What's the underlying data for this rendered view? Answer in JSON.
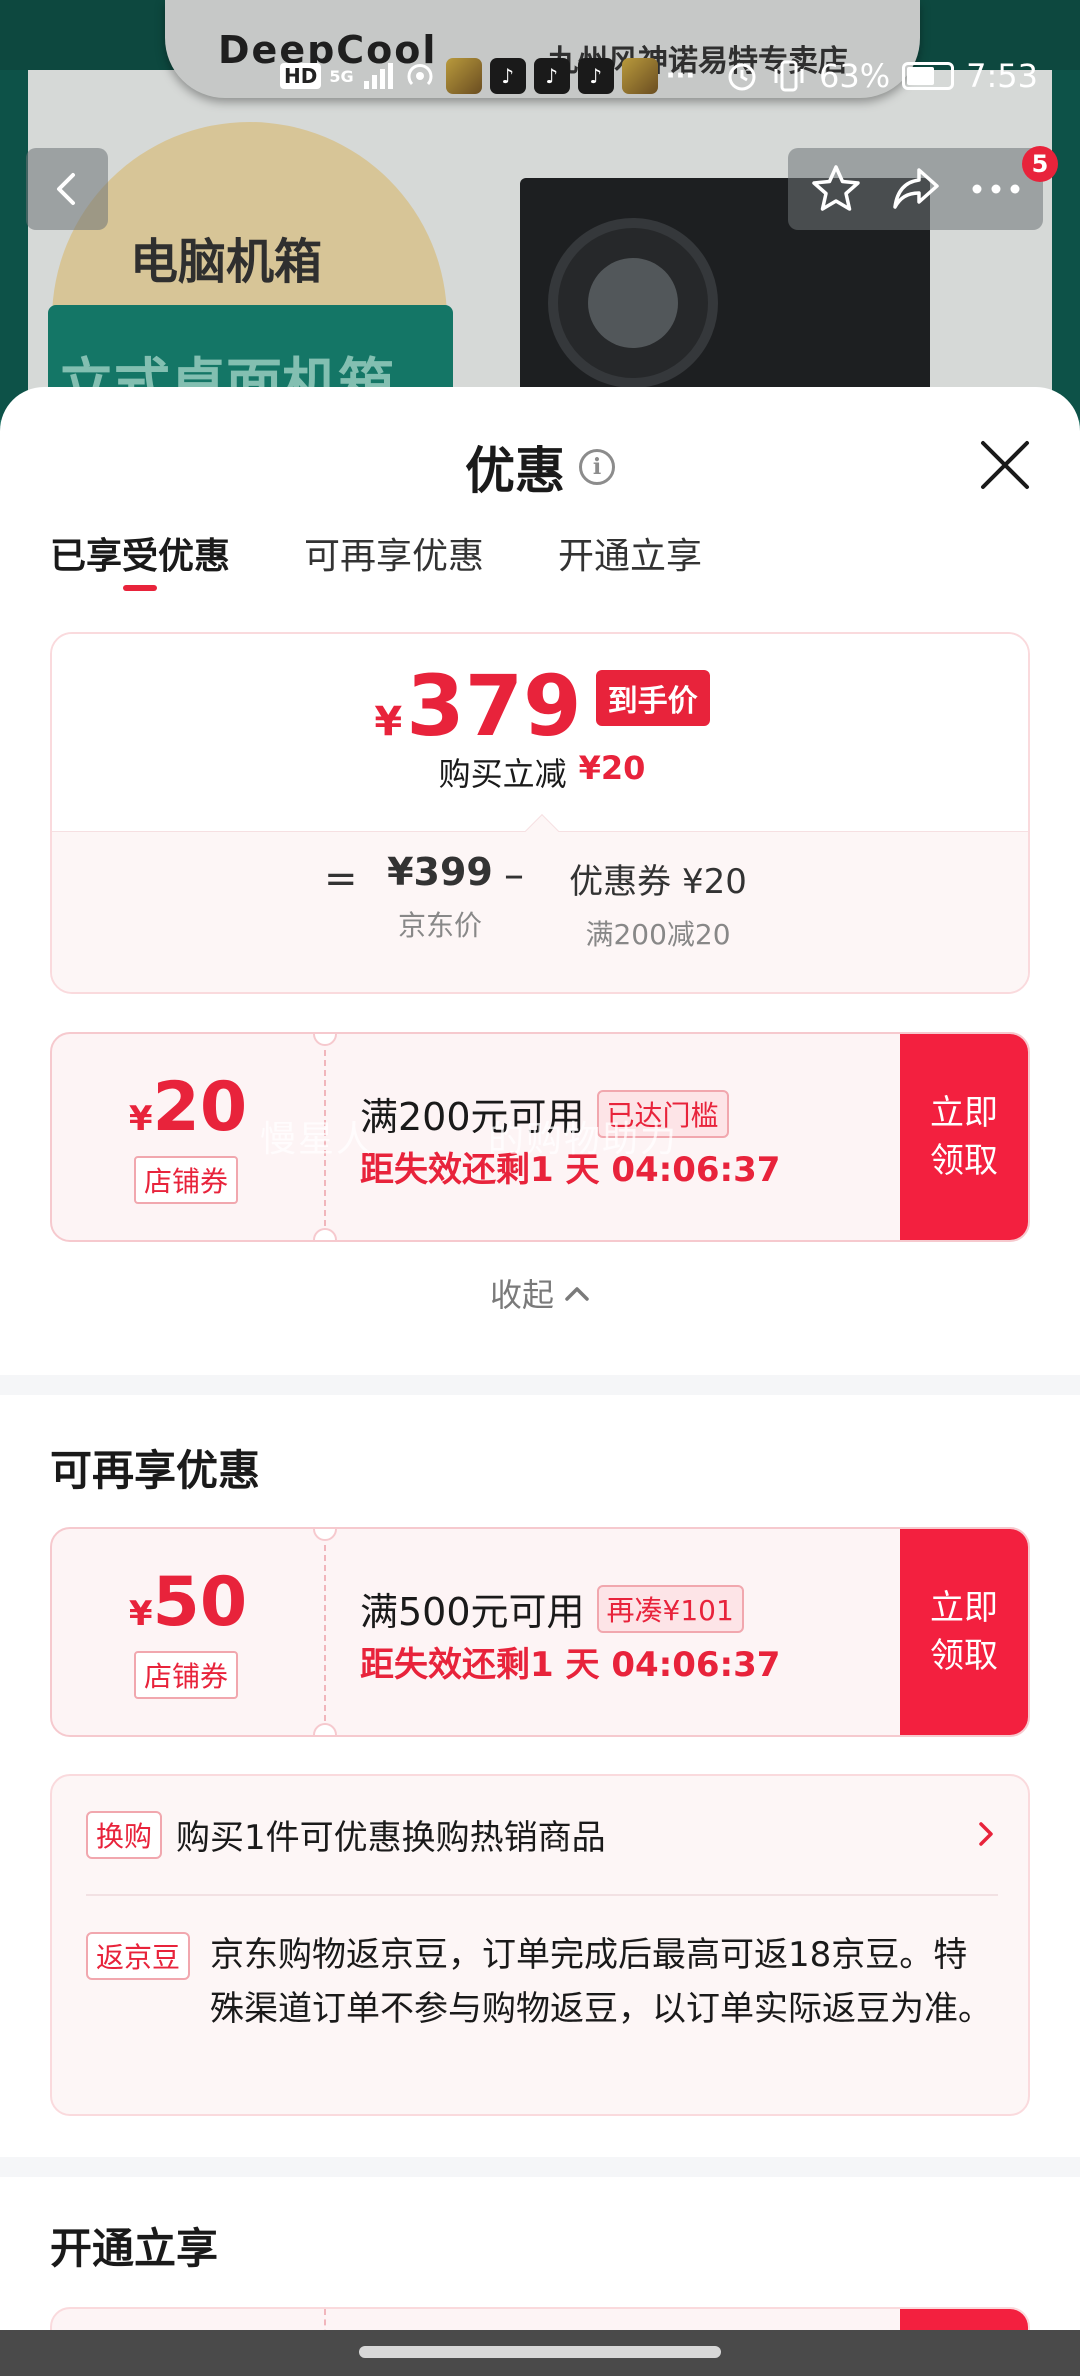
{
  "background": {
    "brand_text": "DeepCool",
    "store_name": "九州风神诺易特专卖店",
    "category_title": "电脑机箱",
    "category_subtitle": "立式桌面机箱",
    "cart_badge": "5"
  },
  "status_bar": {
    "hd": "HD",
    "network": "5G",
    "battery": "63%",
    "time": "7:53",
    "more": "···"
  },
  "sheet": {
    "title": "优惠",
    "tabs": [
      "已享受优惠",
      "可再享优惠",
      "开通立享"
    ],
    "active_tab": 0
  },
  "price_summary": {
    "currency": "¥",
    "final_price": "379",
    "final_tag": "到手价",
    "reduce_label": "购买立减",
    "reduce_amount": "¥20",
    "equals": "=",
    "minus": "–",
    "jd_price": "¥399",
    "jd_price_label": "京东价",
    "coupon_label": "优惠券 ¥20",
    "coupon_condition": "满200减20"
  },
  "coupon_enjoyed": {
    "currency": "¥",
    "amount": "20",
    "type": "店铺券",
    "condition": "满200元可用",
    "status_tag": "已达门槛",
    "timer": "距失效还剩1 天 04:06:37",
    "button": "立即\n领取"
  },
  "collapse_label": "收起",
  "more_section": {
    "title": "可再享优惠",
    "coupon": {
      "currency": "¥",
      "amount": "50",
      "type": "店铺券",
      "condition": "满500元可用",
      "status_tag": "再凑¥101",
      "timer": "距失效还剩1 天 04:06:37",
      "button": "立即\n领取"
    },
    "exchange": {
      "tag": "换购",
      "text": "购买1件可优惠换购热销商品"
    },
    "jingdou": {
      "tag": "返京豆",
      "text": "京东购物返京豆，订单完成后最高可返18京豆。特殊渠道订单不参与购物返豆，以订单实际返豆为准。"
    }
  },
  "open_section": {
    "title": "开通立享"
  },
  "watermark": "慢星人　　　的购物助力",
  "colors": {
    "accent_red": "#e8233b",
    "button_red": "#f3203f",
    "card_pink": "#fdf4f5"
  }
}
